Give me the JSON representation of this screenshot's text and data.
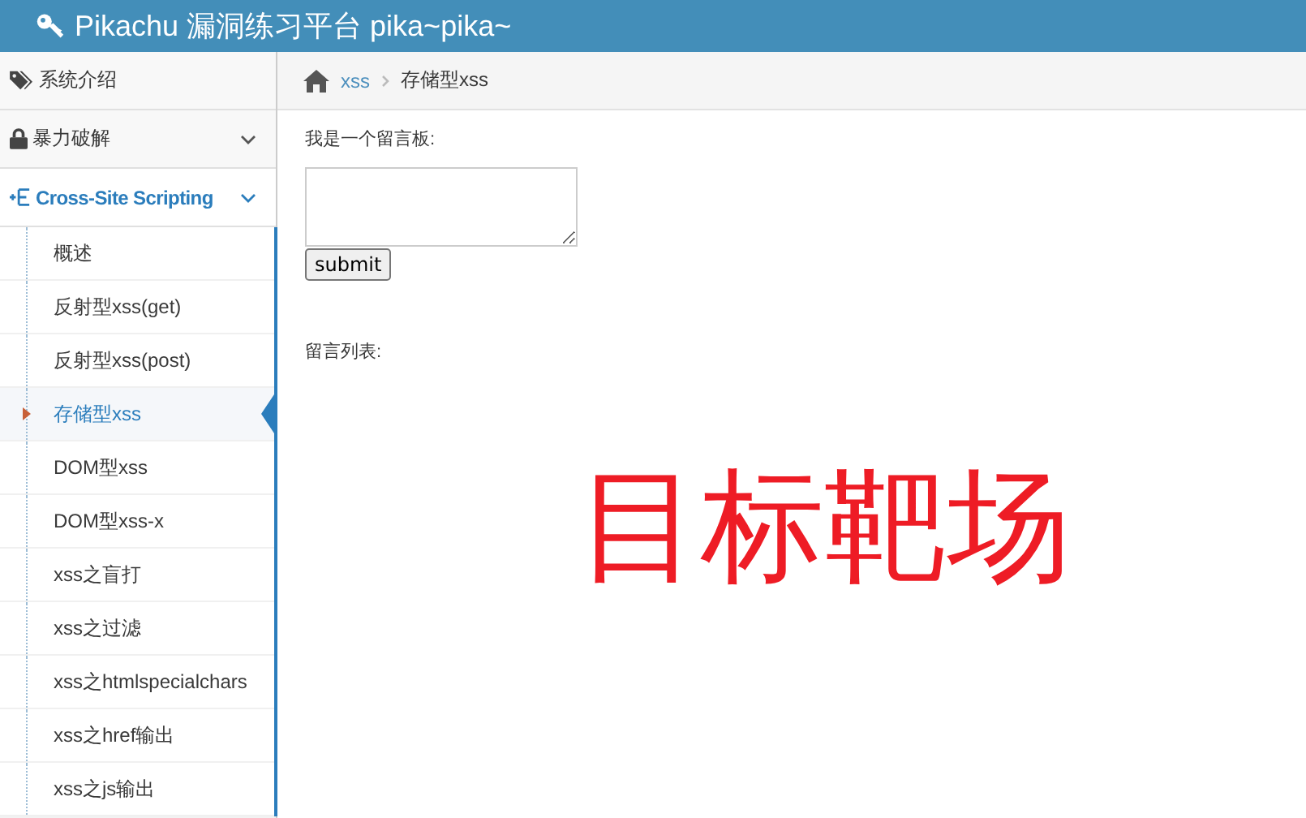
{
  "header": {
    "title": "Pikachu 漏洞练习平台 pika~pika~"
  },
  "sidebar": {
    "items": [
      {
        "label": "系统介绍",
        "expandable": false,
        "selected": false
      },
      {
        "label": "暴力破解",
        "expandable": true,
        "selected": false
      },
      {
        "label": "Cross-Site Scripting",
        "expandable": true,
        "selected": true,
        "children": [
          {
            "label": "概述",
            "selected": false
          },
          {
            "label": "反射型xss(get)",
            "selected": false
          },
          {
            "label": "反射型xss(post)",
            "selected": false
          },
          {
            "label": "存储型xss",
            "selected": true
          },
          {
            "label": "DOM型xss",
            "selected": false
          },
          {
            "label": "DOM型xss-x",
            "selected": false
          },
          {
            "label": "xss之盲打",
            "selected": false
          },
          {
            "label": "xss之过滤",
            "selected": false
          },
          {
            "label": "xss之htmlspecialchars",
            "selected": false
          },
          {
            "label": "xss之href输出",
            "selected": false
          },
          {
            "label": "xss之js输出",
            "selected": false
          }
        ]
      }
    ]
  },
  "breadcrumb": [
    "xss",
    "存储型xss"
  ],
  "form": {
    "label": "我是一个留言板:",
    "button": "submit"
  },
  "list_label": "留言列表:",
  "overlay_text": "目标靶场"
}
